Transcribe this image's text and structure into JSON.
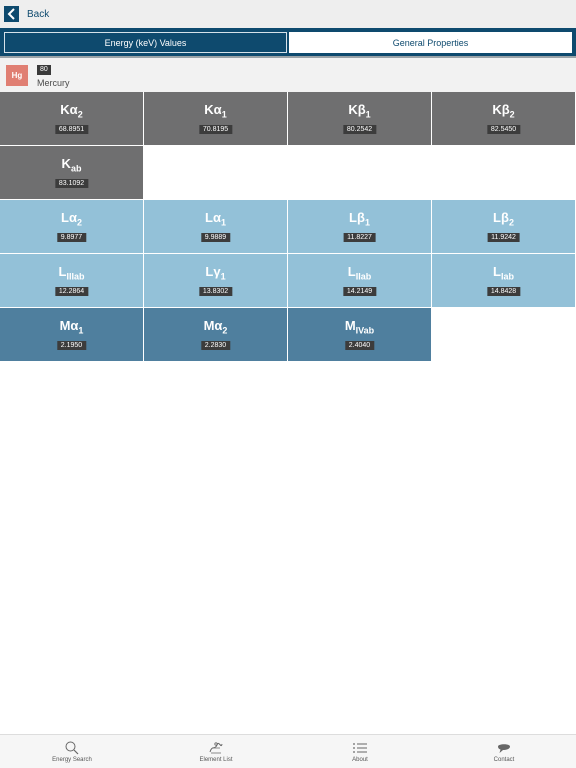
{
  "nav": {
    "back_label": "Back"
  },
  "segments": {
    "active": "Energy (keV) Values",
    "inactive": "General Properties"
  },
  "element": {
    "symbol": "Hg",
    "atomic_number": "80",
    "name": "Mercury"
  },
  "colors": {
    "k_series": "#6f6f70",
    "l_series": "#93c1d8",
    "m_series": "#4f7f9e",
    "accent": "#0e4a6e",
    "symbol_bg": "#e07f73"
  },
  "lines": {
    "k": [
      {
        "base": "Kα",
        "sub": "2",
        "value": "68.8951"
      },
      {
        "base": "Kα",
        "sub": "1",
        "value": "70.8195"
      },
      {
        "base": "Kβ",
        "sub": "1",
        "value": "80.2542"
      },
      {
        "base": "Kβ",
        "sub": "2",
        "value": "82.5450"
      },
      {
        "base": "K",
        "sub": "ab",
        "value": "83.1092"
      }
    ],
    "l": [
      {
        "base": "Lα",
        "sub": "2",
        "value": "9.8977"
      },
      {
        "base": "Lα",
        "sub": "1",
        "value": "9.9889"
      },
      {
        "base": "Lβ",
        "sub": "1",
        "value": "11.8227"
      },
      {
        "base": "Lβ",
        "sub": "2",
        "value": "11.9242"
      },
      {
        "base": "L",
        "sub": "IIIab",
        "value": "12.2864"
      },
      {
        "base": "Lγ",
        "sub": "1",
        "value": "13.8302"
      },
      {
        "base": "L",
        "sub": "IIab",
        "value": "14.2149"
      },
      {
        "base": "L",
        "sub": "Iab",
        "value": "14.8428"
      }
    ],
    "m": [
      {
        "base": "Mα",
        "sub": "1",
        "value": "2.1950"
      },
      {
        "base": "Mα",
        "sub": "2",
        "value": "2.2830"
      },
      {
        "base": "M",
        "sub": "IVab",
        "value": "2.4040"
      }
    ]
  },
  "tabs": [
    {
      "label": "Energy Search",
      "icon": "search-icon"
    },
    {
      "label": "Element List",
      "icon": "element-list-icon"
    },
    {
      "label": "About",
      "icon": "list-icon"
    },
    {
      "label": "Contact",
      "icon": "chat-bubble-icon"
    }
  ]
}
